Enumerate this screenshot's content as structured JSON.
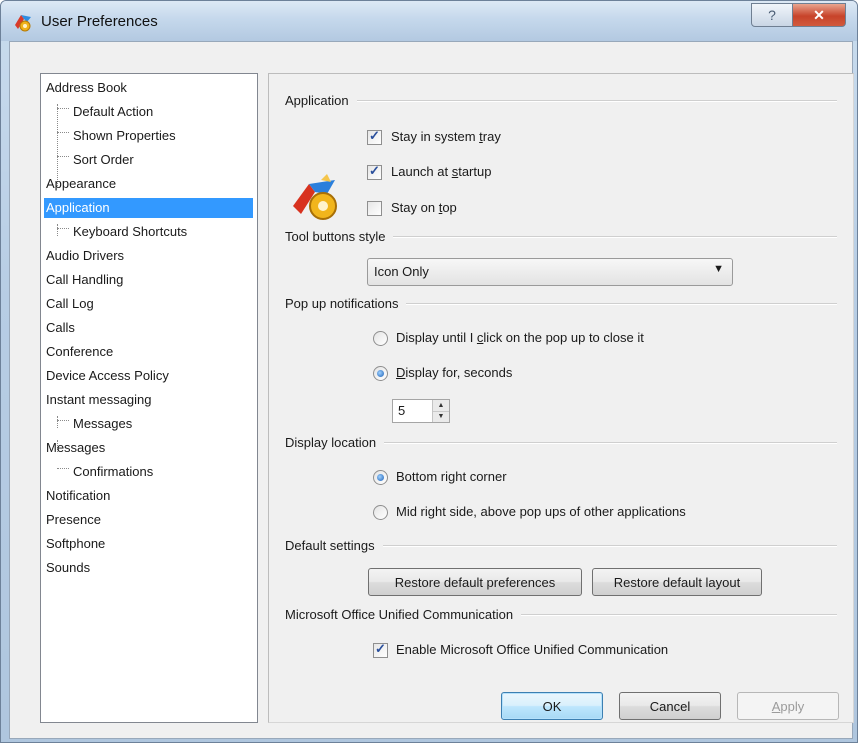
{
  "window": {
    "title": "User Preferences",
    "help_glyph": "?",
    "close_glyph": "✕"
  },
  "tree": {
    "items": [
      {
        "label": "Address Book",
        "level": 0
      },
      {
        "label": "Default Action",
        "level": 1
      },
      {
        "label": "Shown Properties",
        "level": 1
      },
      {
        "label": "Sort Order",
        "level": 1
      },
      {
        "label": "Appearance",
        "level": 0
      },
      {
        "label": "Application",
        "level": 0,
        "selected": true
      },
      {
        "label": "Keyboard Shortcuts",
        "level": 1
      },
      {
        "label": "Audio Drivers",
        "level": 0
      },
      {
        "label": "Call Handling",
        "level": 0
      },
      {
        "label": "Call Log",
        "level": 0
      },
      {
        "label": "Calls",
        "level": 0
      },
      {
        "label": "Conference",
        "level": 0
      },
      {
        "label": "Device Access Policy",
        "level": 0
      },
      {
        "label": "Instant messaging",
        "level": 0
      },
      {
        "label": "Messages",
        "level": 1
      },
      {
        "label": "Messages",
        "level": 0
      },
      {
        "label": "Confirmations",
        "level": 1
      },
      {
        "label": "Notification",
        "level": 0
      },
      {
        "label": "Presence",
        "level": 0
      },
      {
        "label": "Softphone",
        "level": 0
      },
      {
        "label": "Sounds",
        "level": 0
      }
    ]
  },
  "application": {
    "group_title": "Application",
    "stay_in_tray": {
      "pre": "Stay in system ",
      "u": "t",
      "post": "ray",
      "checked": true
    },
    "launch_startup": {
      "pre": "Launch at ",
      "u": "s",
      "post": "tartup",
      "checked": true
    },
    "stay_on_top": {
      "pre": "Stay on ",
      "u": "t",
      "post": "op",
      "checked": false
    }
  },
  "tool_buttons": {
    "group_title": "Tool buttons style",
    "selected": "Icon Only",
    "arrow": "▼"
  },
  "popup": {
    "group_title": "Pop up notifications",
    "option_until_click": {
      "pre": "Display until I ",
      "u": "c",
      "post": "lick on the pop up to close it",
      "checked": false
    },
    "option_seconds": {
      "pre": "",
      "u": "D",
      "post": "isplay for, seconds",
      "checked": true
    },
    "seconds_value": "5",
    "spin_up": "▲",
    "spin_down": "▼"
  },
  "display_location": {
    "group_title": "Display location",
    "bottom_right": {
      "label": "Bottom right corner",
      "checked": true
    },
    "mid_right": {
      "label": "Mid right side, above pop ups of other applications",
      "checked": false
    }
  },
  "default_settings": {
    "group_title": "Default settings",
    "restore_prefs": "Restore default preferences",
    "restore_layout": "Restore default layout"
  },
  "office": {
    "group_title": "Microsoft Office Unified Communication",
    "enable": {
      "label": "Enable Microsoft Office Unified Communication",
      "checked": true
    }
  },
  "footer": {
    "ok": "OK",
    "cancel": "Cancel",
    "apply_u": "A",
    "apply_rest": "pply"
  },
  "colors": {
    "selection": "#3399ff",
    "default_button_border": "#3c7fb1"
  }
}
